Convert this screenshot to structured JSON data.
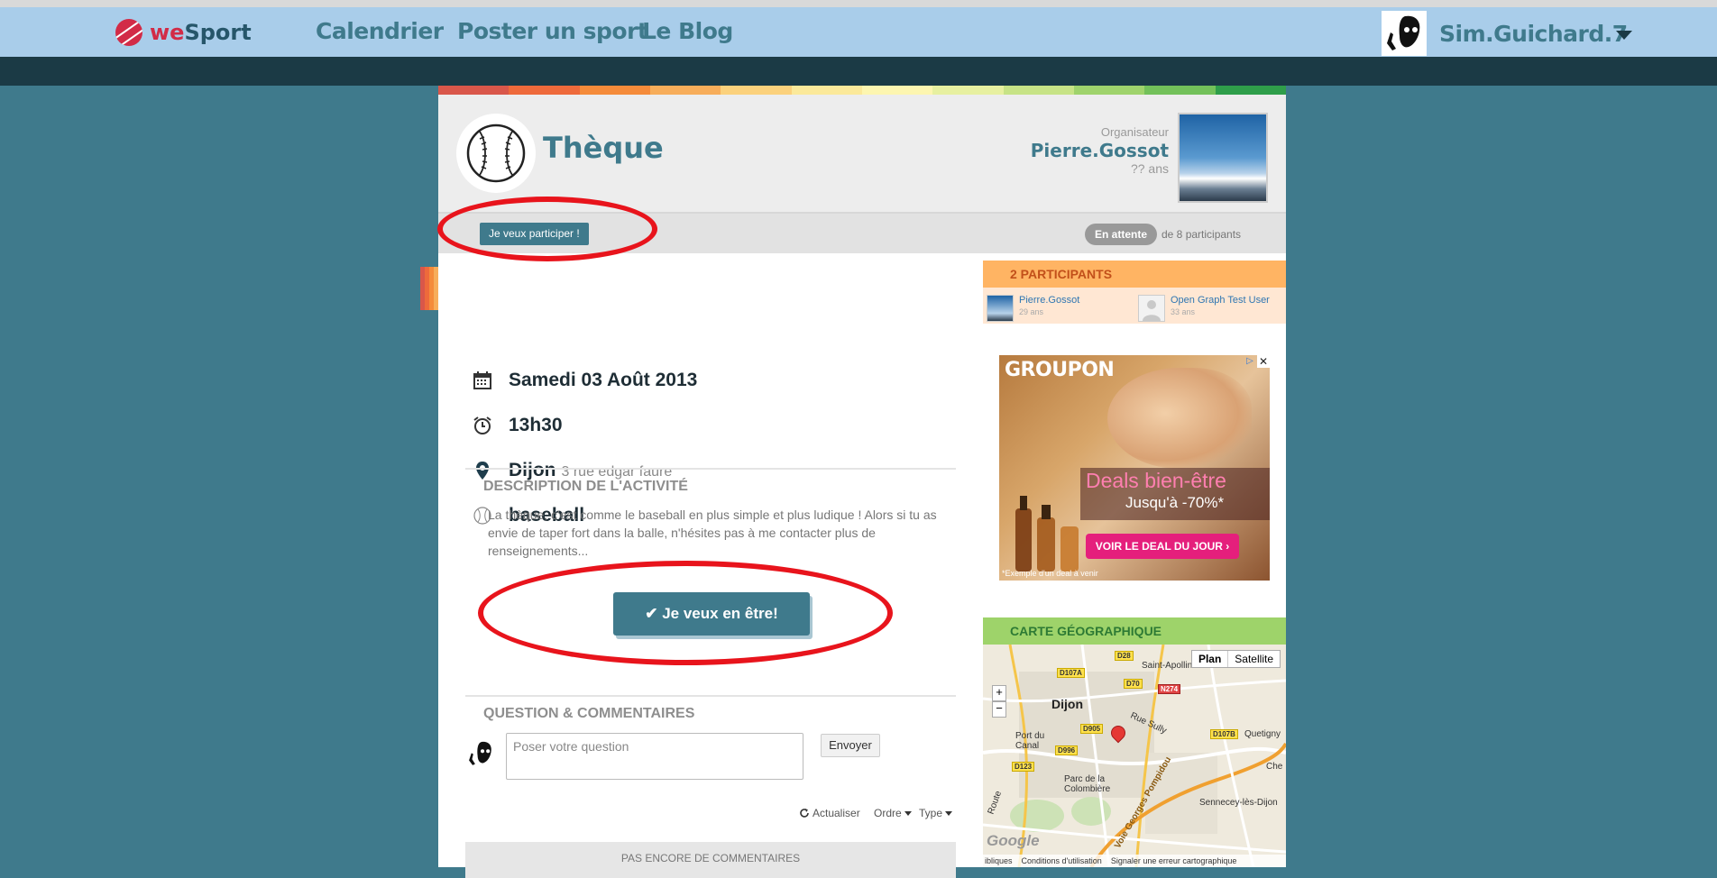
{
  "navbar": {
    "brand_we": "we",
    "brand_sport": "Sport",
    "links": [
      "Calendrier",
      "Poster un sport",
      "Le Blog"
    ],
    "user_name": "Sim.Guichard.7"
  },
  "rainbow_colors": [
    "#d9574a",
    "#ee6a3b",
    "#f58b3a",
    "#f7ad5a",
    "#fbd17c",
    "#fbe99a",
    "#fdf6b0",
    "#e7f0a0",
    "#c7e386",
    "#9fd36c",
    "#73c15a",
    "#2f9e4a"
  ],
  "event": {
    "sport_title": "Thèque",
    "organizer_label": "Organisateur",
    "organizer_name": "Pierre.Gossot",
    "organizer_age": "?? ans",
    "join_small_label": "Je veux participer !",
    "status_badge": "En attente",
    "participants_of": "de 8 participants",
    "date": "Samedi 03 Août 2013",
    "time": "13h30",
    "city": "Dijon",
    "address": "3 rue edgar faure",
    "sport": "baseball"
  },
  "description": {
    "title": "DESCRIPTION DE L'ACTIVITÉ",
    "text": "La thèque, c'est comme le baseball en plus simple et plus ludique ! Alors si tu as envie de taper fort dans la balle, n'hésites pas à me contacter plus de renseignements..."
  },
  "join_big_label": "✔ Je veux en être!",
  "comments": {
    "title": "QUESTION & COMMENTAIRES",
    "input_placeholder": "Poser votre question",
    "send_label": "Envoyer",
    "refresh_label": "Actualiser",
    "order_label": "Ordre",
    "type_label": "Type",
    "empty_text": "PAS ENCORE DE COMMENTAIRES"
  },
  "participants": {
    "title": "2 PARTICIPANTS",
    "list": [
      {
        "name": "Pierre.Gossot",
        "age": "29 ans"
      },
      {
        "name": "Open Graph Test User",
        "age": "33 ans"
      }
    ]
  },
  "ad": {
    "brand": "GROUPON",
    "headline": "Deals bien-être",
    "subline": "Jusqu'à -70%*",
    "cta": "VOIR LE DEAL DU JOUR ›",
    "footnote": "*Exemple d'un deal à venir",
    "close": "✕",
    "info": "▷"
  },
  "map": {
    "title": "CARTE GÉOGRAPHIQUE",
    "btn_plan": "Plan",
    "btn_satellite": "Satellite",
    "zoom_in": "+",
    "zoom_out": "−",
    "city": "Dijon",
    "places": [
      "Saint-Apollinaire",
      "Port du Canal",
      "Parc de la Colombière",
      "Quetigny",
      "Sennecey-lès-Dijon",
      "Che",
      "Rue Sully",
      "Voie Georges Pompidou",
      "Route"
    ],
    "roads": [
      "D28",
      "D107A",
      "D70",
      "N274",
      "D905",
      "D107B",
      "D996",
      "D123"
    ],
    "google": "Google",
    "footer": [
      "ibliques",
      "Conditions d'utilisation",
      "Signaler une erreur cartographique"
    ]
  },
  "annotation_color": "#e8141c"
}
